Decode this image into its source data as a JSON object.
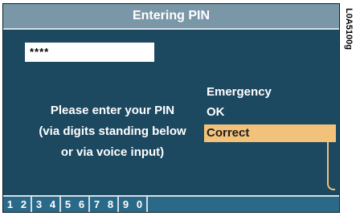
{
  "title": "Entering PIN",
  "pin_value": "****",
  "prompt_lines": [
    "Please enter your PIN",
    "(via digits standing below",
    "or via voice input)"
  ],
  "menu": {
    "items": [
      "Emergency",
      "OK",
      "Correct"
    ],
    "selected": "Correct"
  },
  "digit_pairs": [
    [
      "1",
      "2"
    ],
    [
      "3",
      "4"
    ],
    [
      "5",
      "6"
    ],
    [
      "7",
      "8"
    ],
    [
      "9",
      "0"
    ]
  ],
  "figure_code": "L0A5100g",
  "colors": {
    "screen_bg": "#1c4860",
    "titlebar_bg": "#7a97a8",
    "highlight": "#f2c27a",
    "digit_bg": "#2a6a88"
  }
}
